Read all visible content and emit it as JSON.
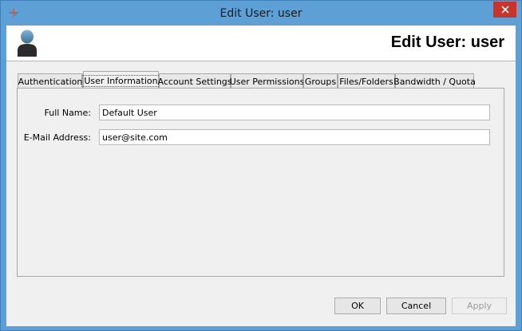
{
  "window": {
    "title": "Edit User: user"
  },
  "header": {
    "title": "Edit User: user"
  },
  "tabs": [
    {
      "label": "Authentication",
      "active": false
    },
    {
      "label": "User Information",
      "active": true
    },
    {
      "label": "Account Settings",
      "active": false
    },
    {
      "label": "User Permissions",
      "active": false
    },
    {
      "label": "Groups",
      "active": false
    },
    {
      "label": "Files/Folders",
      "active": false
    },
    {
      "label": "Bandwidth / Quota",
      "active": false
    }
  ],
  "form": {
    "full_name": {
      "label": "Full Name:",
      "value": "Default User"
    },
    "email": {
      "label": "E-Mail Address:",
      "value": "user@site.com"
    }
  },
  "buttons": {
    "ok": "OK",
    "cancel": "Cancel",
    "apply": "Apply"
  },
  "icons": {
    "app": "app-logo-icon",
    "close": "close-icon",
    "user": "user-avatar-icon"
  },
  "colors": {
    "titlebar": "#5ca0d6",
    "close_button": "#c7342b",
    "window_background": "#f0f0f0"
  }
}
